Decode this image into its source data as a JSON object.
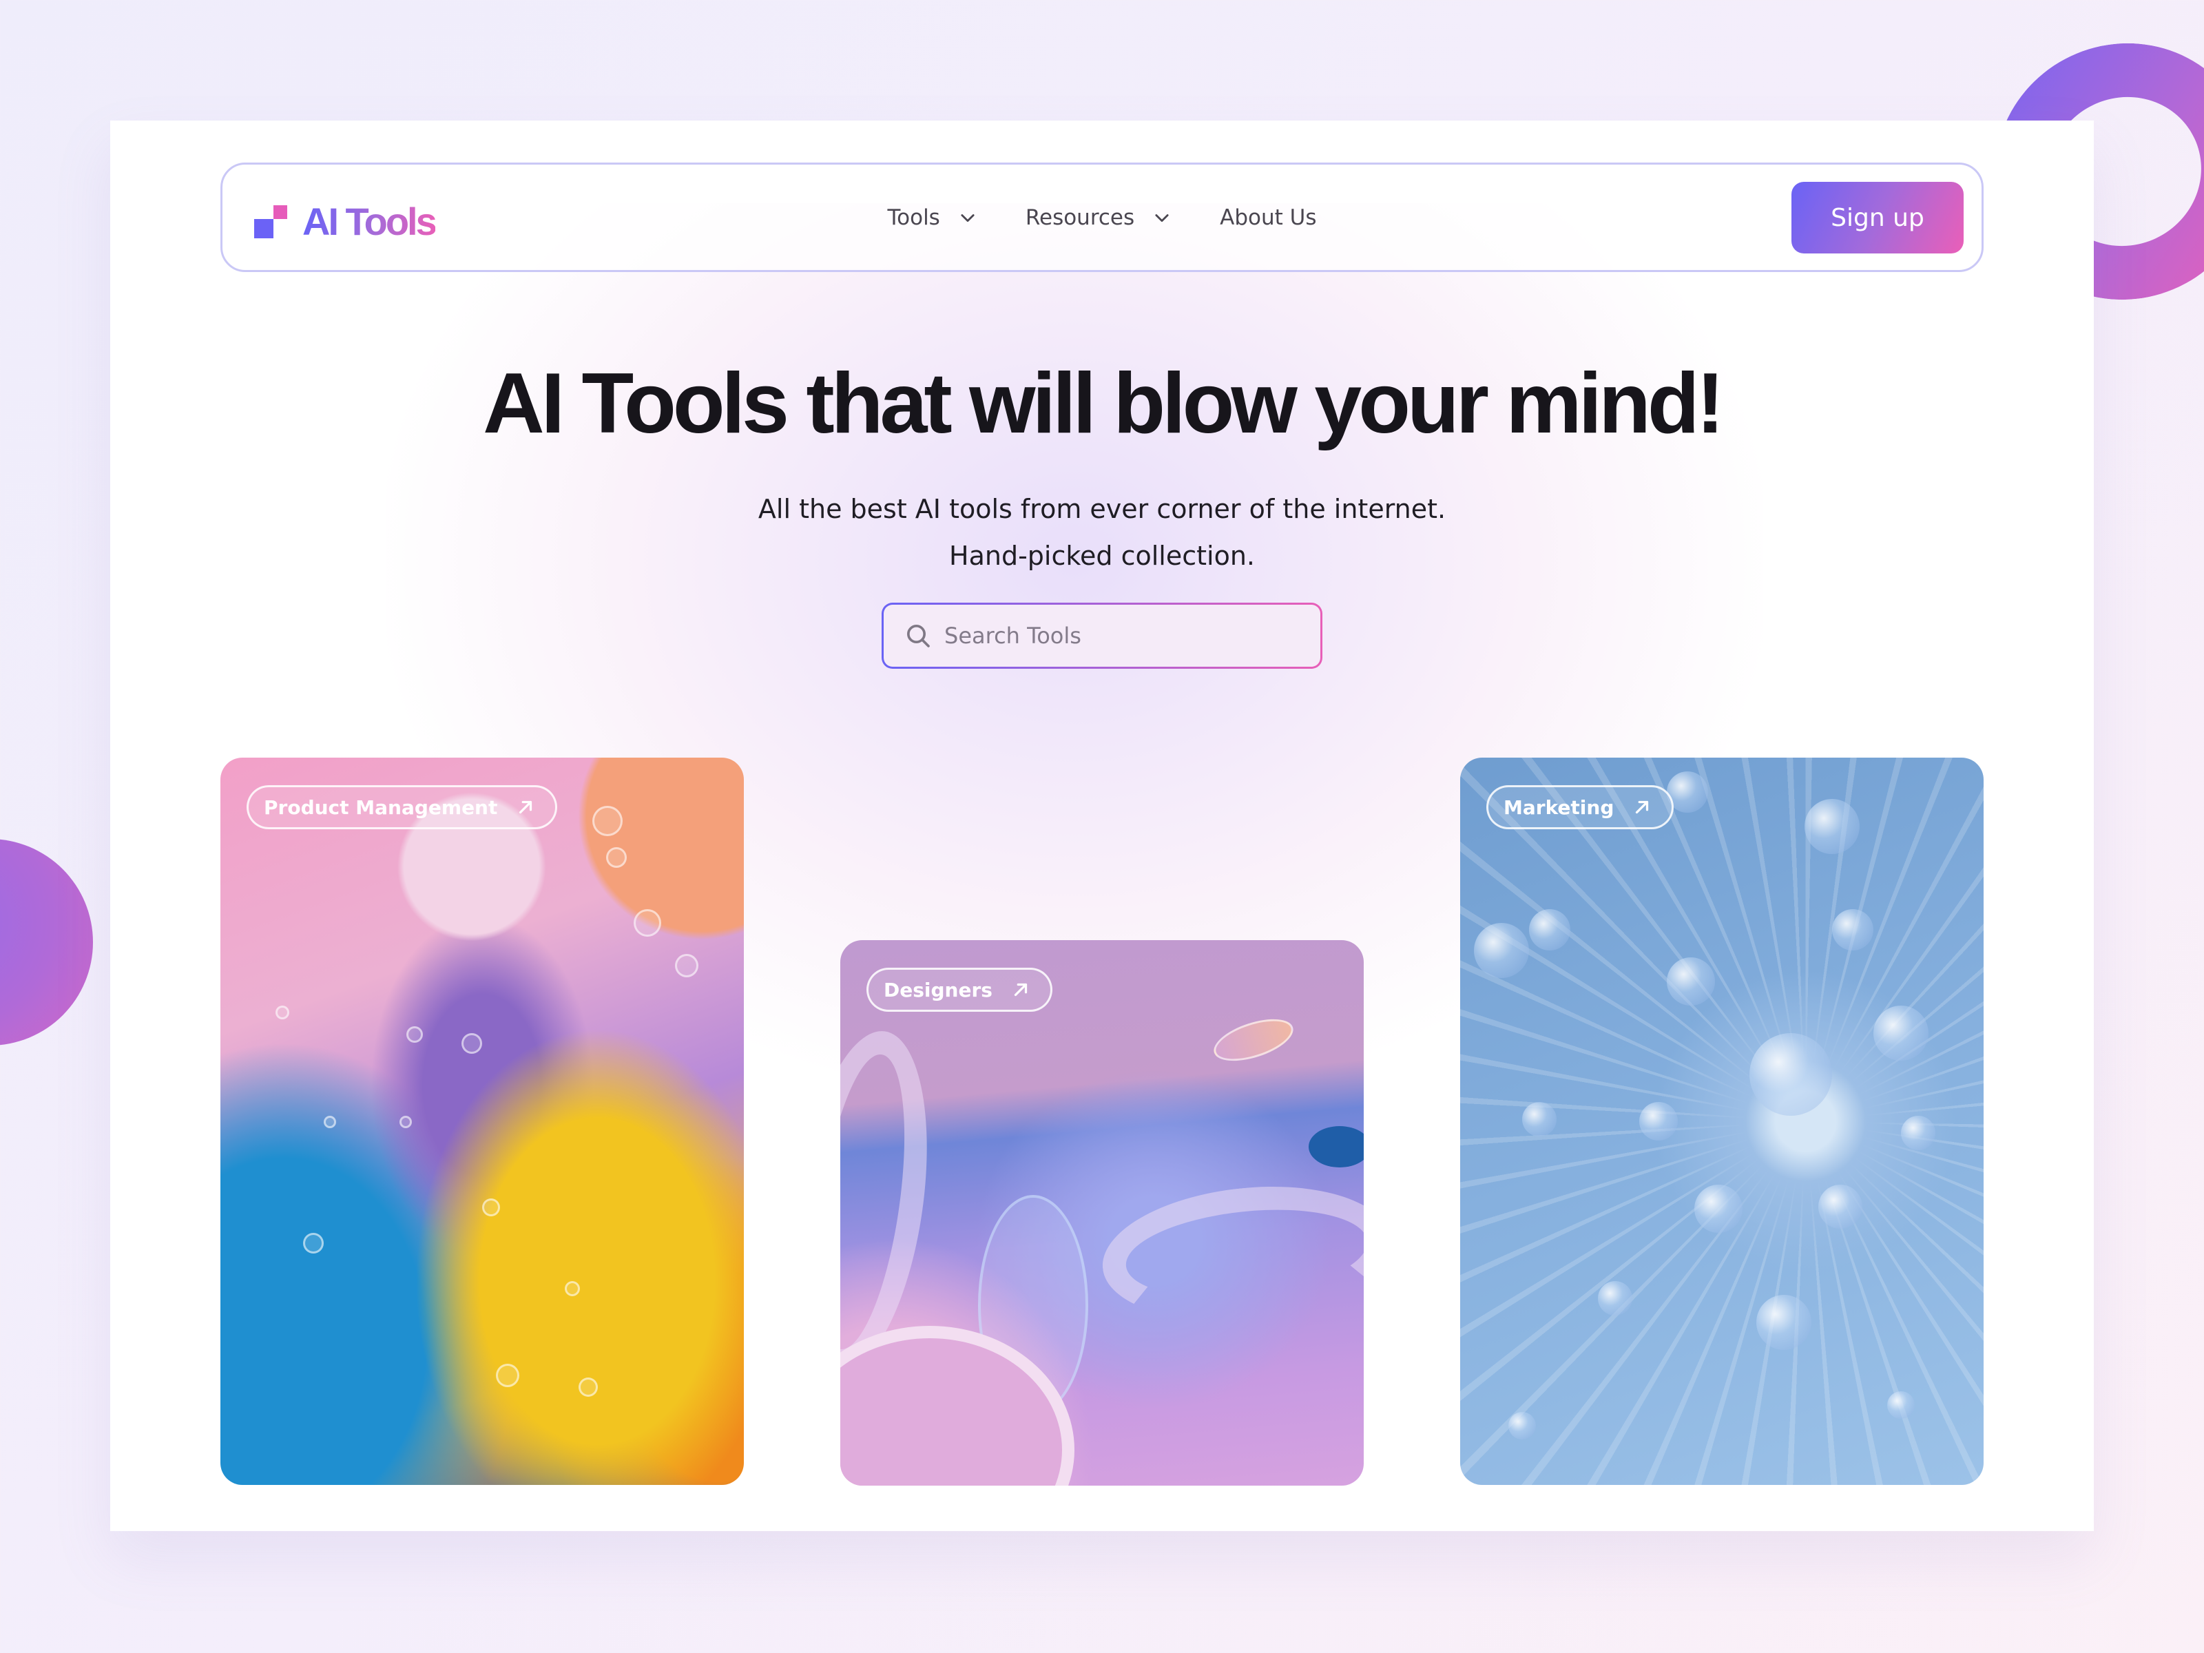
{
  "brand": {
    "name": "AI Tools",
    "colors": {
      "primary": "#6a63f5",
      "accent": "#e85fb8",
      "nav_border": "#cac8f6",
      "heading": "#17151b"
    }
  },
  "nav": {
    "items": [
      {
        "label": "Tools",
        "icon": "chevron-down-icon",
        "has_dropdown": true
      },
      {
        "label": "Resources",
        "icon": "chevron-down-icon",
        "has_dropdown": true
      },
      {
        "label": "About Us",
        "has_dropdown": false
      }
    ],
    "signup_label": "Sign up"
  },
  "hero": {
    "title": "AI Tools that will blow your mind!",
    "subtitle_line1": "All the best AI tools from ever corner of the internet.",
    "subtitle_line2": "Hand-picked collection."
  },
  "search": {
    "placeholder": "Search Tools",
    "value": "",
    "icon": "search-icon"
  },
  "cards": [
    {
      "tag": "Product Management",
      "icon": "arrow-up-right-icon",
      "theme": "colorful oil bubbles"
    },
    {
      "tag": "Designers",
      "icon": "arrow-up-right-icon",
      "theme": "glass tubes on purple"
    },
    {
      "tag": "Marketing",
      "icon": "arrow-up-right-icon",
      "theme": "blue glass burst"
    }
  ]
}
